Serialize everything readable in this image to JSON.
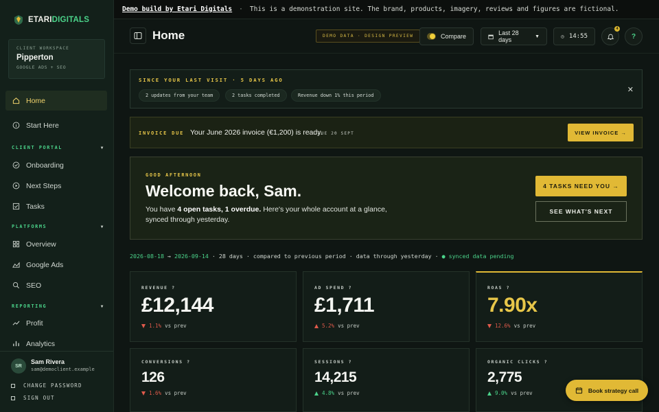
{
  "banner": {
    "strong": "Demo build by Etari Digitals",
    "separator": "·",
    "text": "This is a demonstration site. The brand, products, imagery, reviews and figures are fictional."
  },
  "brand": {
    "part_a": "ETARI",
    "part_b": "DIGITALS"
  },
  "workspace": {
    "kicker": "Client Workspace",
    "name": "Pipperton",
    "sub": "GOOGLE ADS + SEO"
  },
  "sidebar": {
    "items": [
      {
        "label": "Home",
        "icon": "home-icon"
      },
      {
        "label": "Start Here",
        "icon": "info-icon"
      },
      {
        "label": "Onboarding",
        "icon": "check-circle-icon"
      },
      {
        "label": "Next Steps",
        "icon": "play-circle-icon"
      },
      {
        "label": "Tasks",
        "icon": "checkbox-icon"
      },
      {
        "label": "Overview",
        "icon": "grid-icon"
      },
      {
        "label": "Google Ads",
        "icon": "area-chart-icon"
      },
      {
        "label": "SEO",
        "icon": "search-icon"
      },
      {
        "label": "Profit",
        "icon": "trend-icon"
      },
      {
        "label": "Analytics",
        "icon": "bar-chart-icon"
      }
    ],
    "sections": {
      "client_portal": "CLIENT PORTAL",
      "platforms": "PLATFORMS",
      "reporting": "REPORTING"
    }
  },
  "user": {
    "initials": "SR",
    "name": "Sam Rivera",
    "email": "sam@democlient.example",
    "change_password": "CHANGE PASSWORD",
    "sign_out": "SIGN OUT"
  },
  "header": {
    "title": "Home",
    "demo_pill": "DEMO DATA · DESIGN PREVIEW",
    "compare": "Compare",
    "range": "Last 28 days",
    "time": "14:55",
    "notif_count": "4",
    "help": "?"
  },
  "since": {
    "title": "SINCE YOUR LAST VISIT · 5 DAYS AGO",
    "chips": [
      "2 updates from your team",
      "2 tasks completed",
      "Revenue down 1% this period"
    ],
    "close": "✕"
  },
  "invoice": {
    "tag": "INVOICE DUE",
    "text": "Your June 2026 invoice (€1,200) is ready.",
    "due": "DUE 20 SEPT",
    "button": "VIEW INVOICE →"
  },
  "welcome": {
    "kicker": "GOOD AFTERNOON",
    "title": "Welcome back, Sam.",
    "body_pre": "You have ",
    "body_bold": "4 open tasks, 1 overdue.",
    "body_post": " Here's your whole account at a glance, synced through yesterday.",
    "tasks_button": "4 TASKS NEED YOU →",
    "next_button": "SEE WHAT'S NEXT"
  },
  "range_line": {
    "start": "2026-08-18",
    "arrow": "→",
    "end": "2026-09-14",
    "rest": " · 28 days · compared to previous period · data through yesterday · ",
    "pending": "● synced data pending"
  },
  "kpis": [
    {
      "label": "REVENUE  ?",
      "value": "£12,144",
      "delta": "1.1%",
      "direction": "down",
      "suffix": "vs prev"
    },
    {
      "label": "AD SPEND  ?",
      "value": "£1,711",
      "delta": "5.2%",
      "direction": "down",
      "suffix": "vs prev"
    },
    {
      "label": "ROAS  ?",
      "value": "7.90x",
      "delta": "12.6%",
      "direction": "down",
      "suffix": "vs prev"
    },
    {
      "label": "CONVERSIONS  ?",
      "value": "126",
      "delta": "1.6%",
      "direction": "down",
      "suffix": "vs prev"
    },
    {
      "label": "SESSIONS  ?",
      "value": "14,215",
      "delta": "4.8%",
      "direction": "up",
      "suffix": "vs prev"
    },
    {
      "label": "ORGANIC CLICKS  ?",
      "value": "2,775",
      "delta": "9.0%",
      "direction": "up",
      "suffix": "vs prev"
    }
  ],
  "book_button": "Book strategy call",
  "colors": {
    "accent_gold": "#e1b935",
    "accent_green": "#4bd38a",
    "negative": "#e05a4b"
  }
}
